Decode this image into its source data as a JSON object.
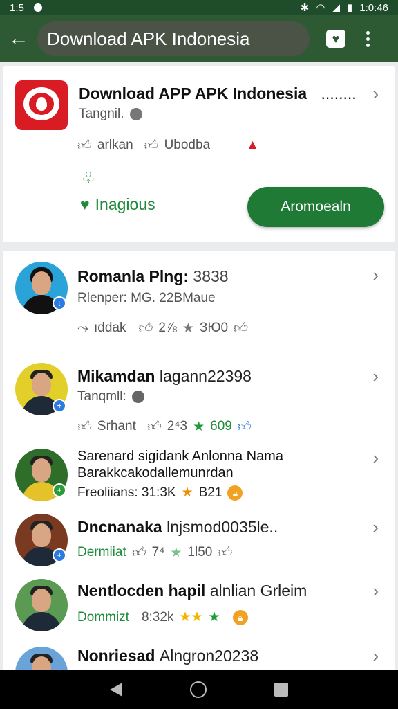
{
  "status_bar": {
    "time": "1:5",
    "right_text": "1:0:46"
  },
  "app_bar": {
    "search_query": "Download APK Indonesia"
  },
  "featured": {
    "title": "Download APP APK Indonesia",
    "title_suffix": "........",
    "subtitle": "Tangnil.",
    "reaction1": "arlkan",
    "reaction2": "Ubodba",
    "status_label": "Inagious",
    "install_button": "Aromoealn"
  },
  "results": [
    {
      "title": "Romanla Plng:",
      "title_num": "3838",
      "subtitle": "Rlenper: MG. 22BMaue",
      "m1": "ıddak",
      "m2": "2⅞",
      "m3": "ЗЮ0",
      "m1_green": false
    },
    {
      "title": "Mikamdan",
      "title_rest": "lagann22398",
      "subtitle": "Tanqmll:",
      "m1": "Srhant",
      "m2": "2⁴3",
      "m3": "609",
      "m1_green": false
    },
    {
      "title": "Sarenard sigidank Anlonna Nama",
      "title_line2": "Barakkcakodallemunrdan",
      "subtitle": "Freoliians: 31:3K",
      "m3": "B21"
    },
    {
      "title": "Dncnanaka",
      "title_rest": "lnjsmod0035le..",
      "m1": "Dermiiat",
      "m2": "7⁴",
      "m3": "1l50"
    },
    {
      "title": "Nentlocden hapil",
      "title_rest": "alnlian Grleim",
      "m1": "Dommizt",
      "m2": "8:32k"
    },
    {
      "title": "Nonriesad",
      "title_rest": "Alngron20238"
    }
  ],
  "colors": {
    "app_bar": "#2d5a33",
    "accent_green": "#1e7a34",
    "badge_blue": "#2b7be0"
  }
}
